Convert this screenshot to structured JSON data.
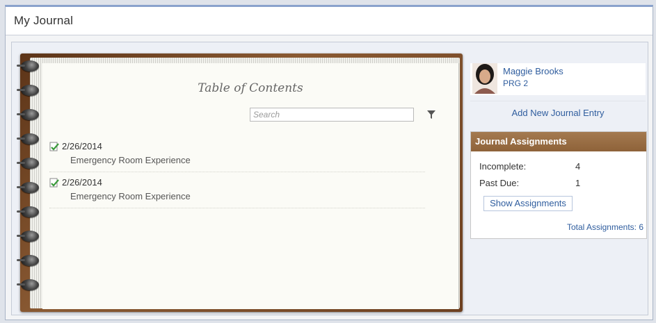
{
  "window": {
    "title": "My Journal"
  },
  "journal": {
    "toc_title": "Table of Contents",
    "search_placeholder": "Search",
    "entries": [
      {
        "date": "2/26/2014",
        "subject": "Emergency Room Experience"
      },
      {
        "date": "2/26/2014",
        "subject": "Emergency Room Experience"
      }
    ]
  },
  "profile": {
    "name": "Maggie Brooks",
    "program": "PRG 2"
  },
  "actions": {
    "add_entry_label": "Add New Journal Entry"
  },
  "assignments": {
    "header": "Journal Assignments",
    "incomplete_label": "Incomplete:",
    "incomplete_value": "4",
    "past_due_label": "Past Due:",
    "past_due_value": "1",
    "show_button_label": "Show Assignments",
    "total_label": "Total Assignments: 6"
  },
  "colors": {
    "link": "#2f5d9e",
    "cover_brown": "#8a5a33",
    "header_brown": "#9b6f45",
    "page": "#fbfbf6"
  },
  "icons": {
    "entry": "edit-document-icon",
    "filter": "filter-icon",
    "binding": "spiral-ring-icon"
  }
}
